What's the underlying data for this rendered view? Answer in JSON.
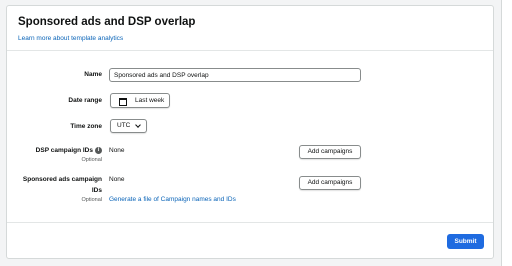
{
  "header": {
    "title": "Sponsored ads and DSP overlap",
    "link": "Learn more about template analytics"
  },
  "form": {
    "name": {
      "label": "Name",
      "value": "Sponsored ads and DSP overlap"
    },
    "date_range": {
      "label": "Date range",
      "value": "Last week"
    },
    "time_zone": {
      "label": "Time zone",
      "value": "UTC"
    },
    "dsp_campaign_ids": {
      "label": "DSP campaign IDs",
      "optional": "Optional",
      "value": "None",
      "button": "Add campaigns"
    },
    "sponsored_ads_campaign_ids": {
      "label_line1": "Sponsored ads campaign",
      "label_line2": "IDs",
      "optional": "Optional",
      "value": "None",
      "button": "Add campaigns",
      "link": "Generate a file of Campaign names and IDs"
    }
  },
  "footer": {
    "submit_label": "Submit"
  },
  "icons": {
    "info": "info-icon",
    "calendar": "calendar-icon",
    "chevron": "chevron-down-icon"
  },
  "colors": {
    "link": "#0a64b8",
    "primary": "#1f6be0"
  }
}
